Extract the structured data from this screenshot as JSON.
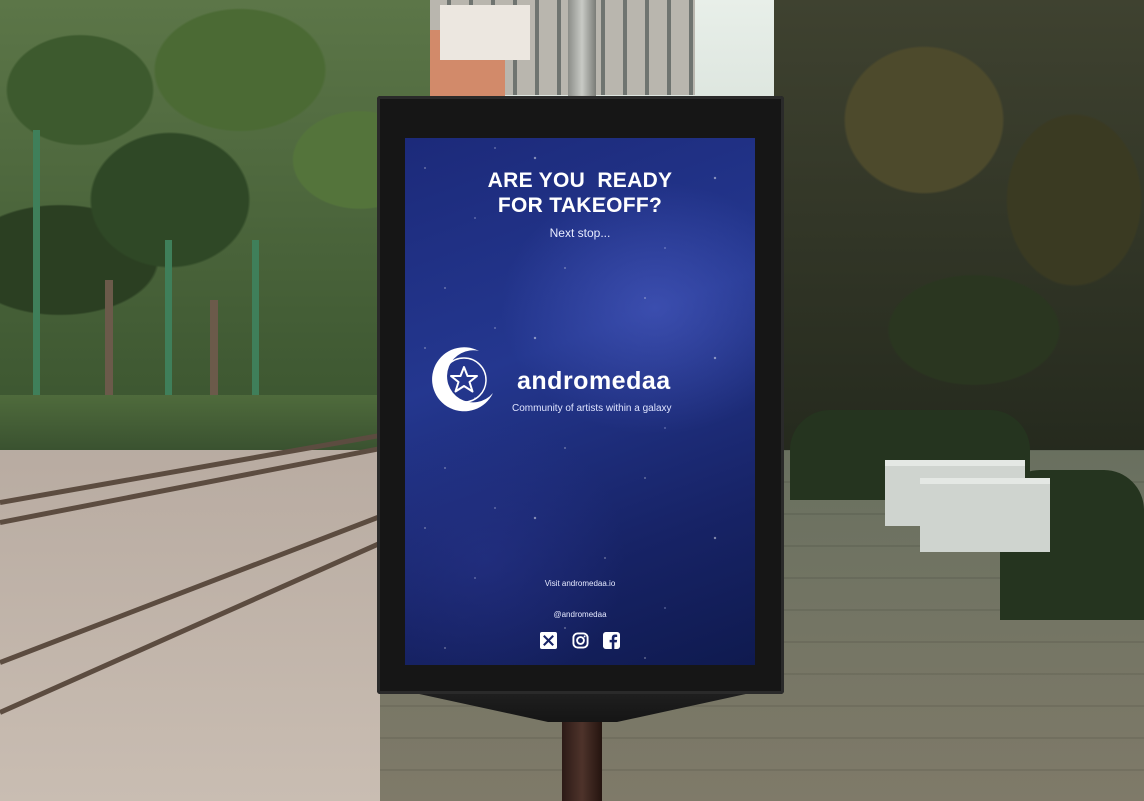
{
  "poster": {
    "headline_line1": "ARE YOU  READY",
    "headline_line2": "FOR TAKEOFF?",
    "subline": "Next stop...",
    "brand_name": "andromedaa",
    "tagline": "Community of artists within a galaxy",
    "visit": "Visit andromedaa.io",
    "handle": "@andromedaa"
  },
  "icons": [
    "x-logo-icon",
    "instagram-icon",
    "facebook-icon",
    "star-logo-icon"
  ],
  "colors": {
    "screen_dark": "#0f1a4f",
    "screen_mid": "#24378f",
    "text": "#ffffff",
    "frame": "#161616"
  }
}
